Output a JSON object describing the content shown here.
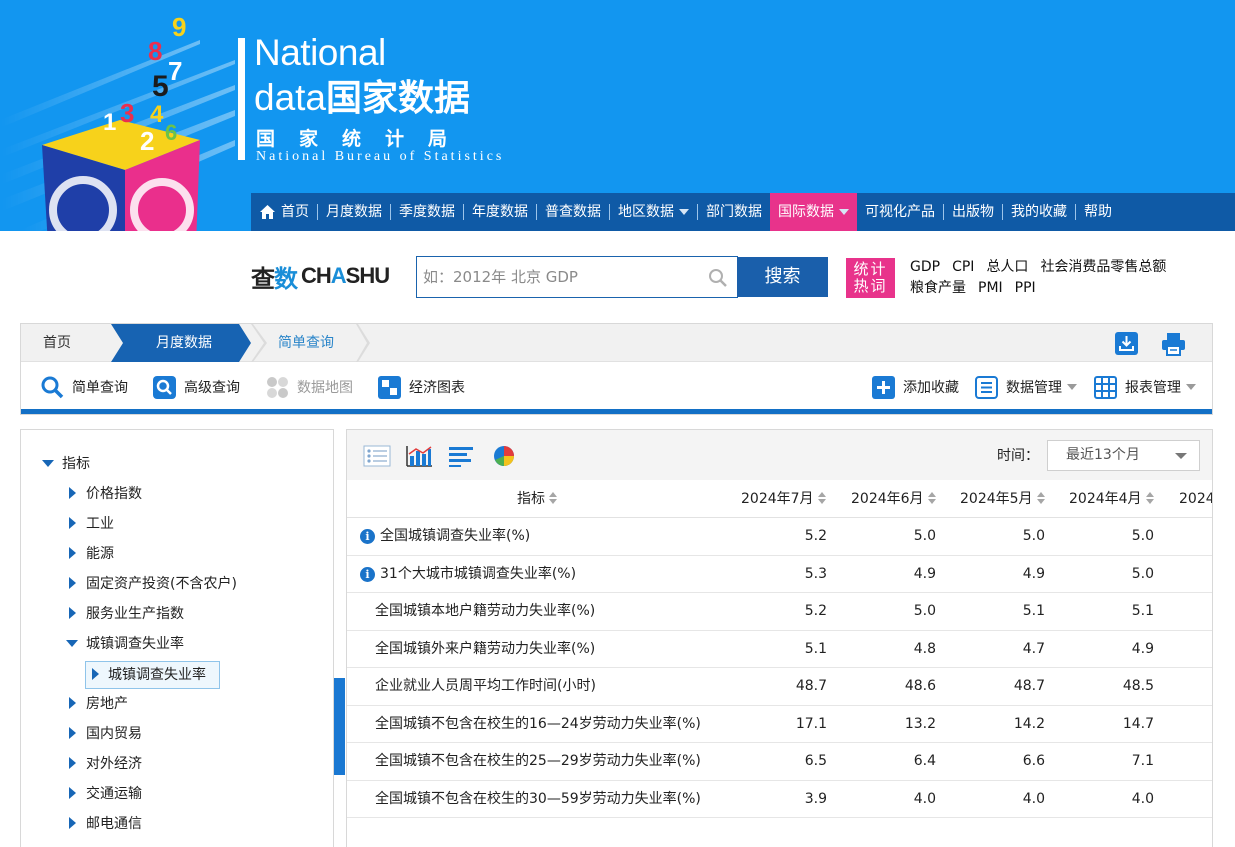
{
  "header": {
    "logo": {
      "line1": "National",
      "line2_en": "data",
      "line2_cn": "国家数据",
      "bureau_cn": "国家统计局",
      "bureau_en": "National Bureau of Statistics"
    },
    "art_digits": [
      "1",
      "2",
      "3",
      "4",
      "5",
      "6",
      "7",
      "8",
      "9"
    ]
  },
  "nav": {
    "items": [
      {
        "label": "首页",
        "icon": "home-icon"
      },
      {
        "label": "月度数据"
      },
      {
        "label": "季度数据"
      },
      {
        "label": "年度数据"
      },
      {
        "label": "普查数据"
      },
      {
        "label": "地区数据",
        "dropdown": true
      },
      {
        "label": "部门数据"
      },
      {
        "label": "国际数据",
        "dropdown": true,
        "active": true
      },
      {
        "label": "可视化产品"
      },
      {
        "label": "出版物"
      },
      {
        "label": "我的收藏"
      },
      {
        "label": "帮助"
      }
    ],
    "active_color": "#e8338b",
    "bg_color": "#0f5aa6"
  },
  "search": {
    "logo_cn_1": "查",
    "logo_cn_2": "数",
    "logo_en_1": "CH",
    "logo_en_2": "A",
    "logo_en_3": "SHU",
    "placeholder": "如：2012年 北京 GDP",
    "button_label": "搜索",
    "hot_badge": "统计热词",
    "hot_words": [
      "GDP",
      "CPI",
      "总人口",
      "社会消费品零售总额",
      "粮食产量",
      "PMI",
      "PPI"
    ]
  },
  "breadcrumb": {
    "home": "首页",
    "monthly": "月度数据",
    "current": "简单查询"
  },
  "toolbar": {
    "simple_query": "简单查询",
    "advanced_query": "高级查询",
    "data_map": "数据地图",
    "econ_chart": "经济图表",
    "add_favorite": "添加收藏",
    "data_manage": "数据管理",
    "report_manage": "报表管理"
  },
  "tree": {
    "root": "指标",
    "items": [
      {
        "label": "价格指数"
      },
      {
        "label": "工业"
      },
      {
        "label": "能源"
      },
      {
        "label": "固定资产投资(不含农户)"
      },
      {
        "label": "服务业生产指数"
      },
      {
        "label": "城镇调查失业率",
        "expanded": true
      },
      {
        "label": "房地产"
      },
      {
        "label": "国内贸易"
      },
      {
        "label": "对外经济"
      },
      {
        "label": "交通运输"
      },
      {
        "label": "邮电通信"
      }
    ],
    "selected_child": "城镇调查失业率"
  },
  "data_panel": {
    "time_label": "时间：",
    "time_value": "最近13个月",
    "columns": [
      "指标",
      "2024年7月",
      "2024年6月",
      "2024年5月",
      "2024年4月",
      "2024"
    ],
    "rows": [
      {
        "name": "全国城镇调查失业率(%)",
        "info": true,
        "values": [
          "5.2",
          "5.0",
          "5.0",
          "5.0"
        ]
      },
      {
        "name": "31个大城市城镇调查失业率(%)",
        "info": true,
        "values": [
          "5.3",
          "4.9",
          "4.9",
          "5.0"
        ]
      },
      {
        "name": "全国城镇本地户籍劳动力失业率(%)",
        "info": false,
        "values": [
          "5.2",
          "5.0",
          "5.1",
          "5.1"
        ]
      },
      {
        "name": "全国城镇外来户籍劳动力失业率(%)",
        "info": false,
        "values": [
          "5.1",
          "4.8",
          "4.7",
          "4.9"
        ]
      },
      {
        "name": "企业就业人员周平均工作时间(小时)",
        "info": false,
        "values": [
          "48.7",
          "48.6",
          "48.7",
          "48.5"
        ]
      },
      {
        "name": "全国城镇不包含在校生的16—24岁劳动力失业率(%)",
        "info": false,
        "values": [
          "17.1",
          "13.2",
          "14.2",
          "14.7"
        ]
      },
      {
        "name": "全国城镇不包含在校生的25—29岁劳动力失业率(%)",
        "info": false,
        "values": [
          "6.5",
          "6.4",
          "6.6",
          "7.1"
        ]
      },
      {
        "name": "全国城镇不包含在校生的30—59岁劳动力失业率(%)",
        "info": false,
        "values": [
          "3.9",
          "4.0",
          "4.0",
          "4.0"
        ]
      }
    ]
  }
}
